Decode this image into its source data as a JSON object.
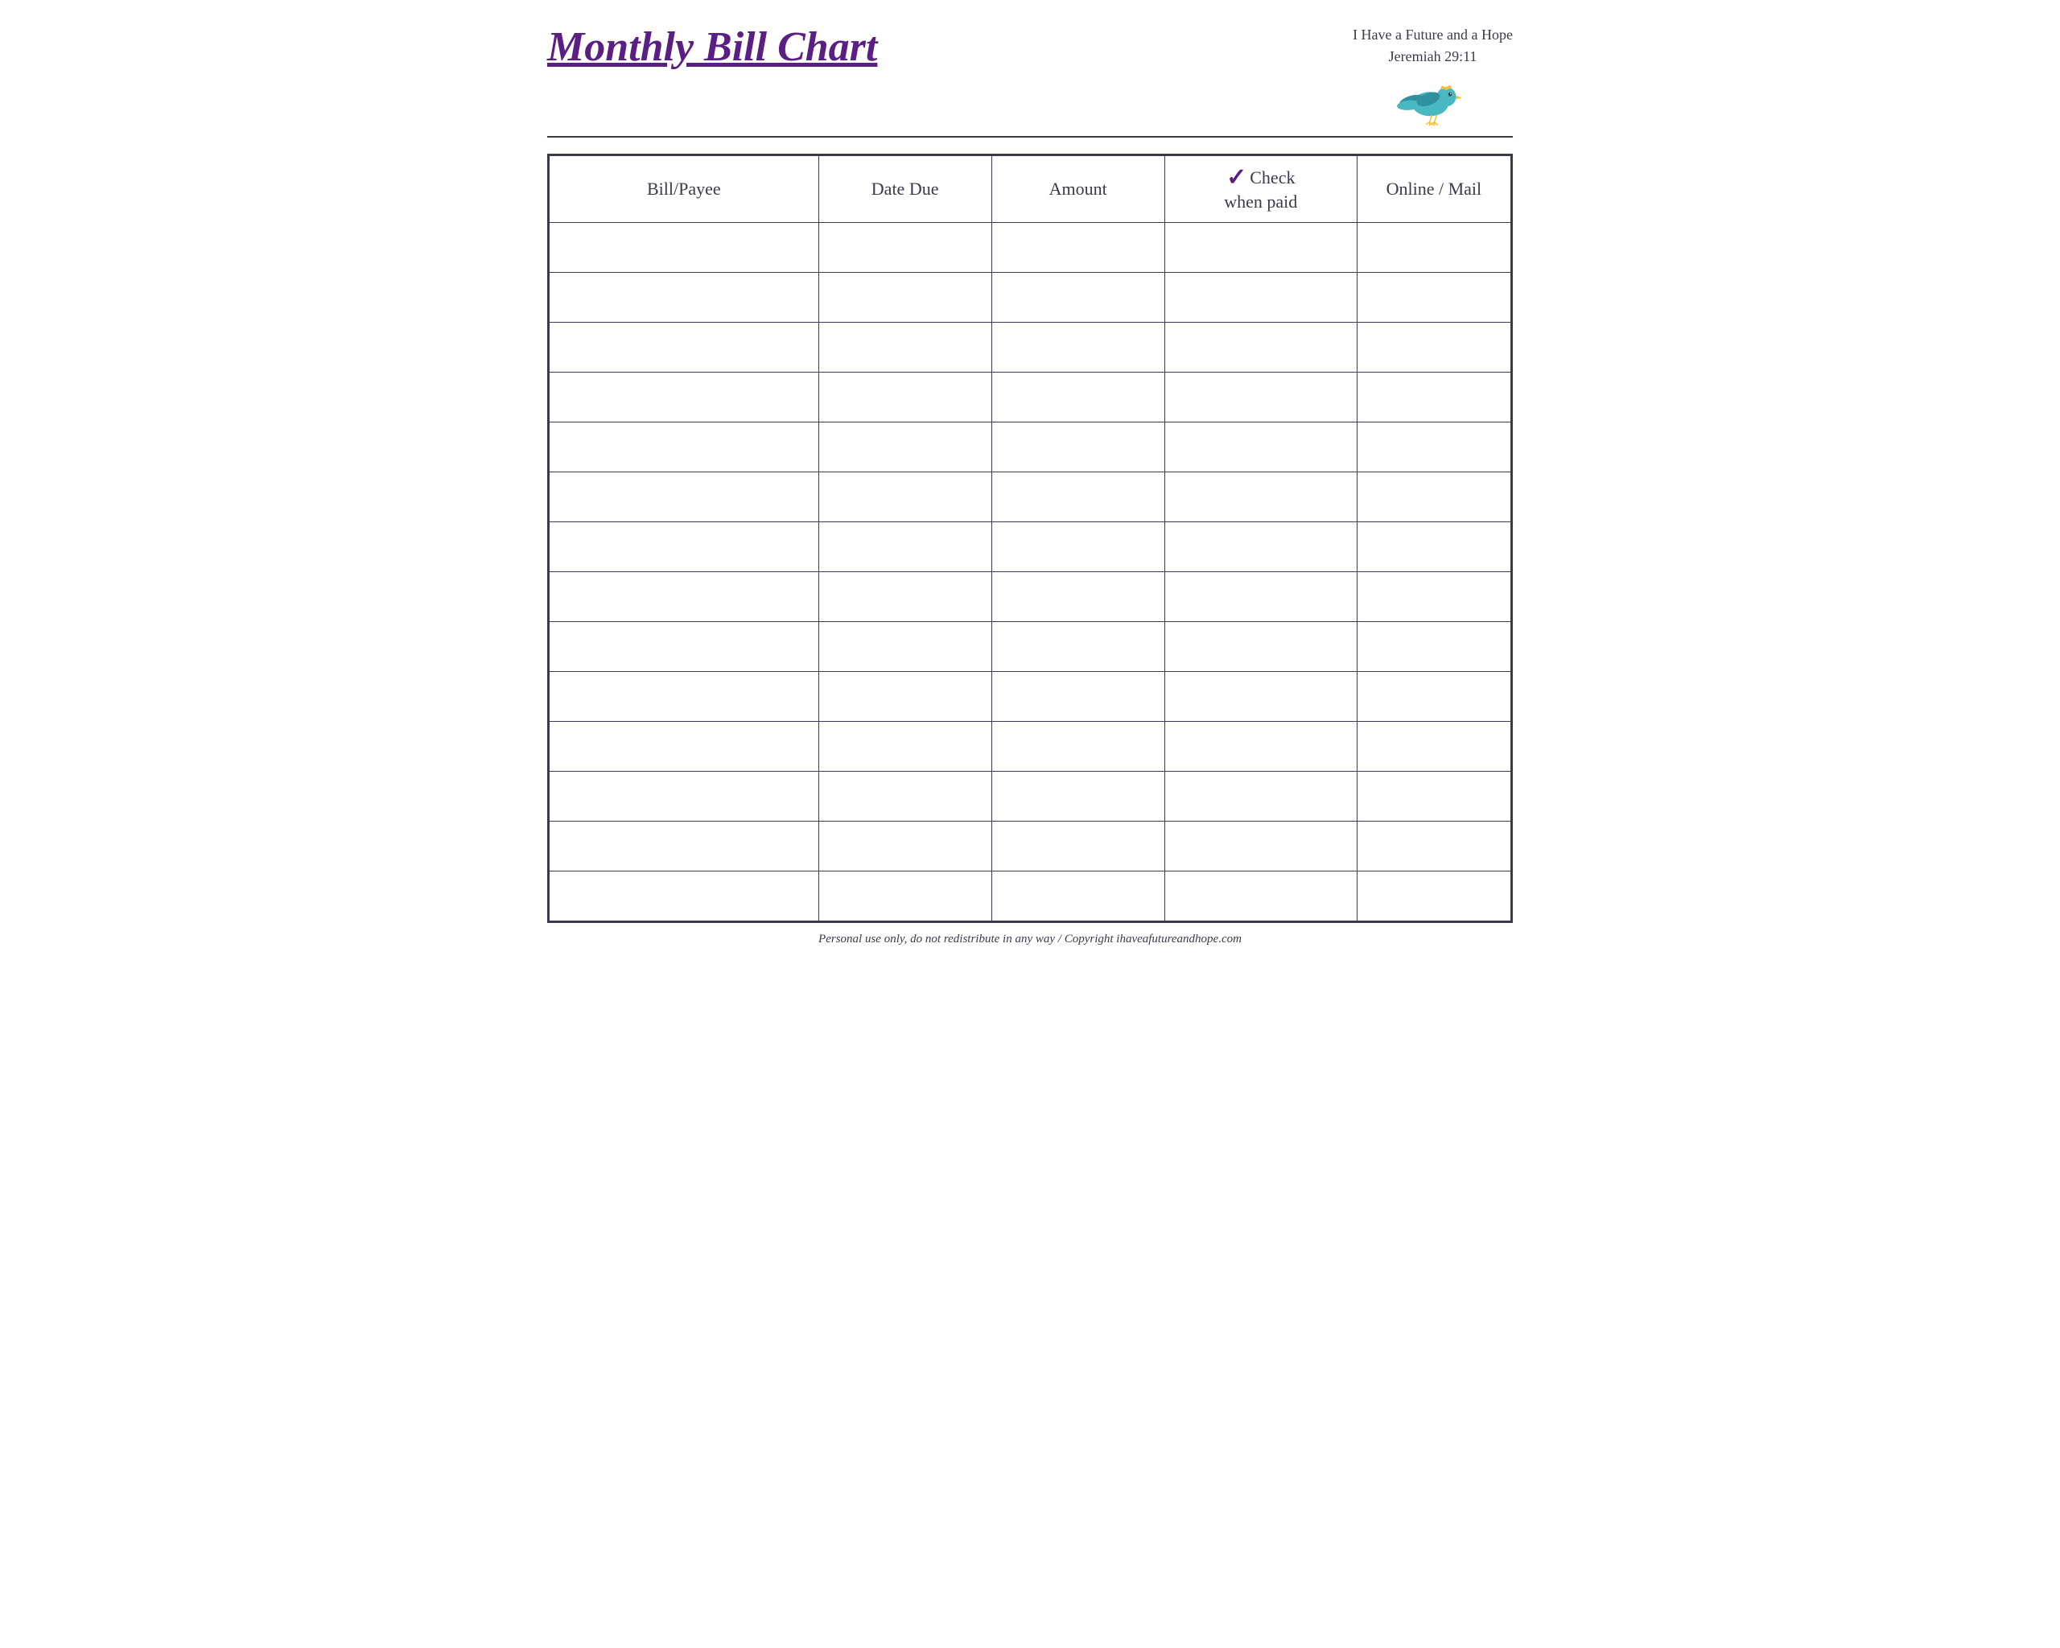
{
  "header": {
    "title": "Monthly Bill Chart",
    "scripture_line1": "I Have a Future and a Hope",
    "scripture_line2": "Jeremiah 29:11"
  },
  "table": {
    "columns": [
      {
        "id": "bill-payee",
        "label": "Bill/Payee"
      },
      {
        "id": "date-due",
        "label": "Date Due"
      },
      {
        "id": "amount",
        "label": "Amount"
      },
      {
        "id": "check-when-paid",
        "label_check": "Check",
        "label_when_paid": "when paid"
      },
      {
        "id": "online-mail",
        "label": "Online / Mail"
      }
    ],
    "row_count": 14
  },
  "footer": {
    "text": "Personal use only, do not redistribute in any way / Copyright ihaveafutureandhope.com"
  },
  "colors": {
    "title": "#5b1e82",
    "border": "#3a3a4a",
    "checkmark": "#5b1e82",
    "text": "#3a3a4a"
  }
}
